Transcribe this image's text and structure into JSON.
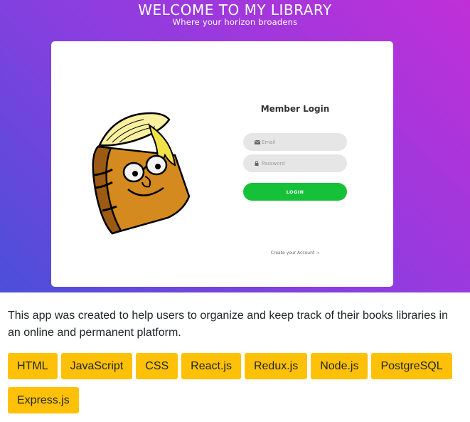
{
  "hero": {
    "title": "WELCOME TO MY LIBRARY",
    "subtitle": "Where your horizon broadens"
  },
  "login": {
    "title": "Member Login",
    "email_placeholder": "Email",
    "password_placeholder": "Password",
    "button_label": "LOGIN",
    "create_account": "Create your Account →"
  },
  "description": "This app was created to help users to organize and keep track of their books libraries in an online and permanent platform.",
  "tags": [
    "HTML",
    "JavaScript",
    "CSS",
    "React.js",
    "Redux.js",
    "Node.js",
    "PostgreSQL",
    "Express.js"
  ],
  "colors": {
    "gradient_start": "#4a4fd9",
    "gradient_end": "#c02fd8",
    "login_button": "#16c13a",
    "tag_background": "#ffc107"
  },
  "icons": {
    "email_field": "envelope-icon",
    "password_field": "lock-icon",
    "mascot": "book-mascot"
  }
}
